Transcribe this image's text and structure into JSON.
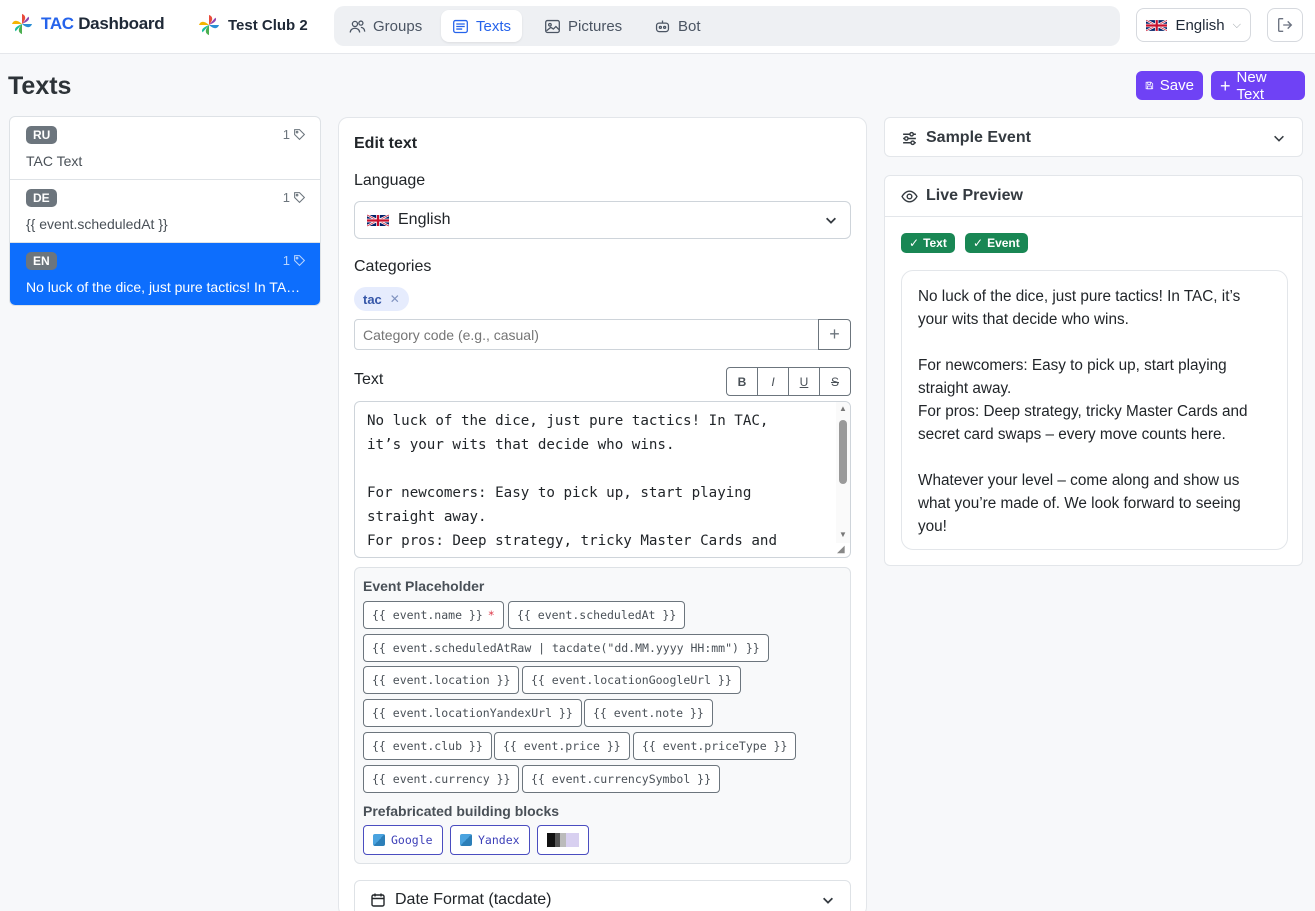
{
  "app": {
    "brand_accent": "TAC",
    "brand_rest": " Dashboard",
    "club_name": "Test Club 2"
  },
  "nav": {
    "tabs": [
      {
        "label": "Groups",
        "icon": "users-icon",
        "active": false
      },
      {
        "label": "Texts",
        "icon": "text-lines-icon",
        "active": true
      },
      {
        "label": "Pictures",
        "icon": "image-icon",
        "active": false
      },
      {
        "label": "Bot",
        "icon": "robot-icon",
        "active": false
      }
    ],
    "language": "English"
  },
  "page": {
    "title": "Texts",
    "save_label": "Save",
    "new_label": "New Text"
  },
  "texts": [
    {
      "lang": "RU",
      "count": "1",
      "snippet": "TAC Text",
      "active": false
    },
    {
      "lang": "DE",
      "count": "1",
      "snippet": "{{ event.scheduledAt }}",
      "active": false
    },
    {
      "lang": "EN",
      "count": "1",
      "snippet": "No luck of the dice, just pure tactics! In TAC, it’s your wits that decide who wins.",
      "active": true
    }
  ],
  "edit": {
    "title": "Edit text",
    "language_label": "Language",
    "language_value": "English",
    "categories_label": "Categories",
    "category_chip": "tac",
    "category_placeholder": "Category code (e.g., casual)",
    "text_label": "Text",
    "format_buttons": [
      "B",
      "I",
      "U",
      "S"
    ],
    "text_value": "No luck of the dice, just pure tactics! In TAC,\nit’s your wits that decide who wins.\n\nFor newcomers: Easy to pick up, start playing\nstraight away.\nFor pros: Deep strategy, tricky Master Cards and\nsecret card swaps – every move counts here.\n\nWhatever your level – come along and show us\nwhat you’re made of. We look forward to seeing\nyou!",
    "placeholder_heading": "Event Placeholder",
    "placeholders": [
      "{{ event.name }}",
      "{{ event.scheduledAt }}",
      "{{ event.scheduledAtRaw | tacdate(\"dd.MM.yyyy HH:mm\") }}",
      "{{ event.location }}",
      "{{ event.locationGoogleUrl }}",
      "{{ event.locationYandexUrl }}",
      "{{ event.note }}",
      "{{ event.club }}",
      "{{ event.price }}",
      "{{ event.priceType }}",
      "{{ event.currency }}",
      "{{ event.currencySymbol }}"
    ],
    "required_marker": "*",
    "blocks_heading": "Prefabricated building blocks",
    "blocks": [
      "Google",
      "Yandex"
    ],
    "date_format_label": "Date Format (tacdate)"
  },
  "sample_event": {
    "title": "Sample Event"
  },
  "live_preview": {
    "title": "Live Preview",
    "badges": [
      "Text",
      "Event"
    ],
    "paragraphs": [
      "No luck of the dice, just pure tactics! In TAC, it’s your wits that decide who wins.",
      "For newcomers: Easy to pick up, start playing straight away.",
      "For pros: Deep strategy, tricky Master Cards and secret card swaps – every move counts here.",
      "Whatever your level – come along and show us what you’re made of. We look forward to seeing you!"
    ]
  },
  "colors": {
    "accent": "#2563eb",
    "primary_button": "#6f42f5",
    "list_active": "#0d6efd",
    "success": "#198754"
  }
}
